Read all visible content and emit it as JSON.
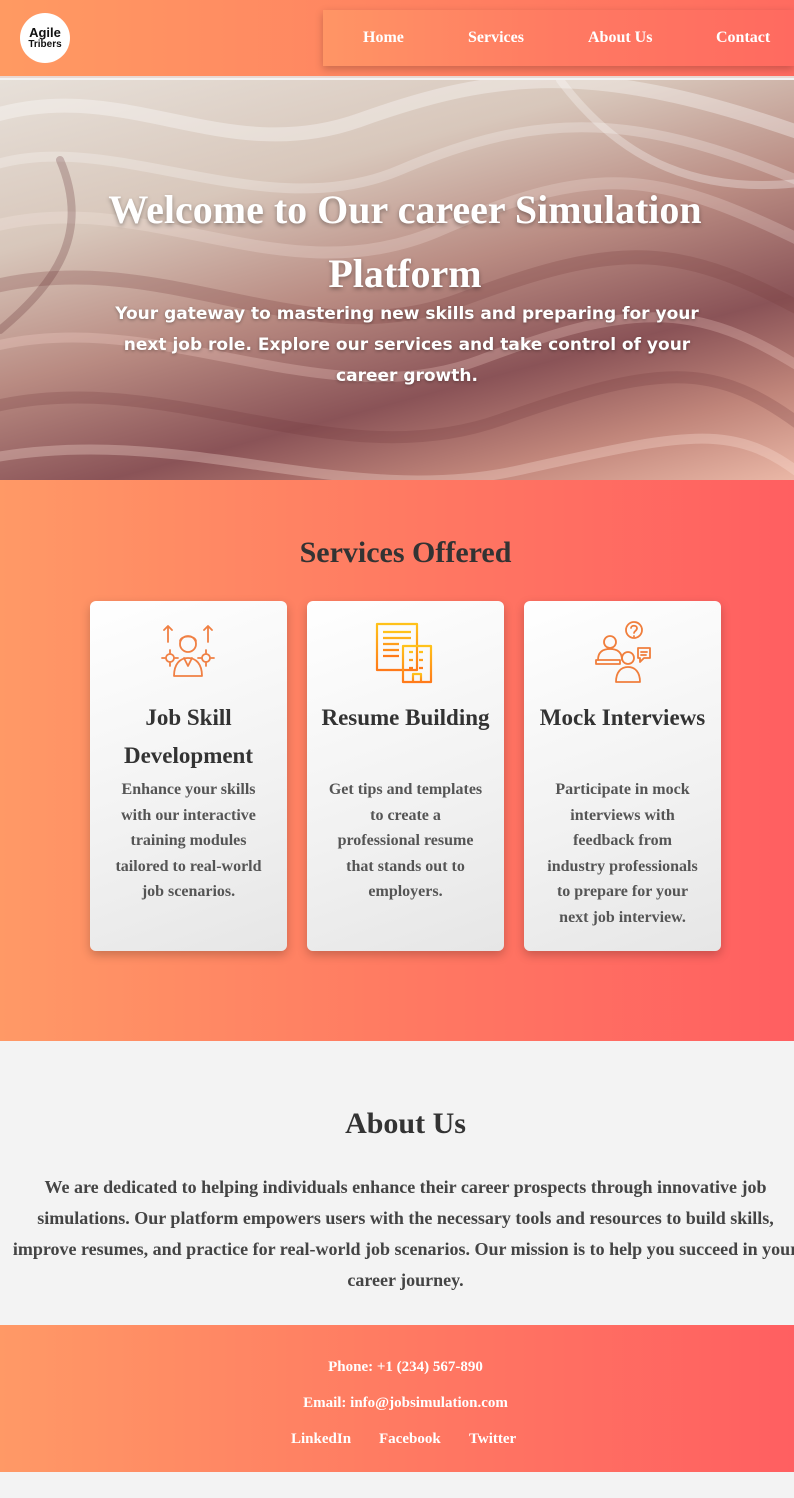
{
  "logo": {
    "line1": "Agile",
    "line2": "Tribers"
  },
  "nav": {
    "items": [
      "Home",
      "Services",
      "About Us",
      "Contact"
    ]
  },
  "hero": {
    "title": "Welcome to Our career Simulation Platform",
    "subtitle": "Your gateway to mastering new skills and preparing for your next job role. Explore our services and take control of your career growth."
  },
  "services": {
    "heading": "Services Offered",
    "cards": [
      {
        "title": "Job Skill Development",
        "description": "Enhance your skills with our interactive training modules tailored to real-world job scenarios.",
        "icon": "skills-icon"
      },
      {
        "title": "Resume Building",
        "description": "Get tips and templates to create a professional resume that stands out to employers.",
        "icon": "resume-building-icon"
      },
      {
        "title": "Mock Interviews",
        "description": "Participate in mock interviews with feedback from industry professionals to prepare for your next job interview.",
        "icon": "interview-icon"
      }
    ]
  },
  "about": {
    "heading": "About Us",
    "text": "We are dedicated to helping individuals enhance their career prospects through innovative job simulations. Our platform empowers users with the necessary tools and resources to build skills, improve resumes, and practice for real-world job scenarios. Our mission is to help you succeed in your career journey."
  },
  "footer": {
    "phone": "Phone: +1 (234) 567-890",
    "email": "Email: info@jobsimulation.com",
    "social": [
      "LinkedIn",
      "Facebook",
      "Twitter"
    ]
  },
  "colors": {
    "gradient_start": "#ff9966",
    "gradient_end": "#ff5f61",
    "text_dark": "#333333",
    "page_bg": "#f3f3f3"
  }
}
